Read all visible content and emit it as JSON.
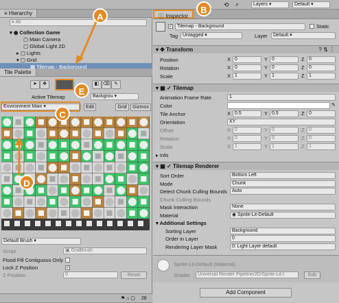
{
  "toolbar": {
    "layers_label": "Layers",
    "layout_label": "Default"
  },
  "hierarchy": {
    "tab": "Hierarchy",
    "search_placeholder": "All",
    "items": [
      "Collection Game",
      "Main Camera",
      "Global Light 2D",
      "Lights",
      "Grid",
      "Tilemap - Background"
    ]
  },
  "palette": {
    "tab": "Tile Palette",
    "active_tilemap_label": "Active Tilemap",
    "active_tilemap_value": "Backgrou",
    "palette_name": "Environment Main",
    "edit_label": "Edit",
    "grid_label": "Grid",
    "gizmos_label": "Gizmos",
    "badge_count": "26",
    "brush_name": "Default Brush",
    "script_label": "Script",
    "script_value": "GridBrush",
    "flood_fill_label": "Flood Fill Contiguous Only",
    "lock_z_label": "Lock Z Position",
    "z_position_label": "Z Position",
    "z_position_value": "0",
    "reset_label": "Reset"
  },
  "inspector": {
    "tab": "Inspector",
    "object_name": "Tilemap - Background",
    "static_label": "Static",
    "tag_label": "Tag",
    "tag_value": "Untagged",
    "layer_label": "Layer",
    "layer_value": "Default",
    "transform": {
      "title": "Transform",
      "position_label": "Position",
      "rotation_label": "Rotation",
      "scale_label": "Scale",
      "position": [
        "0",
        "0",
        "0"
      ],
      "rotation": [
        "0",
        "0",
        "0"
      ],
      "scale": [
        "1",
        "1",
        "1"
      ]
    },
    "tilemap": {
      "title": "Tilemap",
      "frame_rate_label": "Animation Frame Rate",
      "frame_rate": "1",
      "color_label": "Color",
      "anchor_label": "Tile Anchor",
      "anchor": [
        "0.5",
        "0.5",
        "0"
      ],
      "orientation_label": "Orientation",
      "orientation": "XY",
      "offset_label": "Offset",
      "offset": [
        "0",
        "0",
        "0"
      ],
      "rotation_label": "Rotation",
      "rotation": [
        "0",
        "0",
        "0"
      ],
      "scale_label": "Scale",
      "scale": [
        "1",
        "1",
        "1"
      ],
      "info_label": "Info"
    },
    "renderer": {
      "title": "Tilemap Renderer",
      "sort_order_label": "Sort Order",
      "sort_order": "Bottom Left",
      "mode_label": "Mode",
      "mode": "Chunk",
      "detect_label": "Detect Chunk Culling Bounds",
      "detect": "Auto",
      "chunk_label": "Chunk Culling Bounds",
      "mask_label": "Mask Interaction",
      "mask": "None",
      "material_label": "Material",
      "material": "Sprite-Lit-Default",
      "additional_label": "Additional Settings",
      "sorting_layer_label": "Sorting Layer",
      "sorting_layer": "Background",
      "order_label": "Order in Layer",
      "order": "0",
      "rendering_mask_label": "Rendering Layer Mask",
      "rendering_mask": "0: Light Layer default"
    },
    "material_block": {
      "name": "Sprite-Lit-Default (Material)",
      "shader_label": "Shader",
      "shader_value": "Universal Render Pipeline/2D/Sprite-Lit-t"
    },
    "add_component_label": "Add Component"
  },
  "callouts": [
    "A",
    "B",
    "C",
    "D",
    "E"
  ],
  "colors": {
    "accent": "#e38a26",
    "green": "#3ec46a",
    "brown": "#b8843f"
  }
}
